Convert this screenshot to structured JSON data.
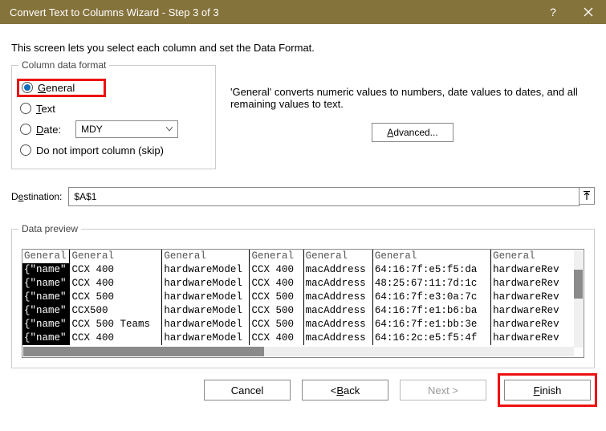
{
  "title": "Convert Text to Columns Wizard - Step 3 of 3",
  "instructions": "This screen lets you select each column and set the Data Format.",
  "format_fieldset": {
    "legend": "Column data format",
    "general": "General",
    "text": "Text",
    "date": "Date:",
    "date_value": "MDY",
    "skip": "Do not import column (skip)"
  },
  "description": "'General' converts numeric values to numbers, date values to dates, and all remaining values to text.",
  "advanced": "Advanced...",
  "destination_label": "Destination:",
  "destination_value": "$A$1",
  "preview_legend": "Data preview",
  "headers": [
    "General",
    "General",
    "General",
    "General",
    "General",
    "General",
    "General"
  ],
  "rows": [
    [
      "{\"name\"",
      "CCX 400",
      "hardwareModel",
      "CCX 400",
      "macAddress",
      "64:16:7f:e5:f5:da",
      "hardwareRev"
    ],
    [
      "{\"name\"",
      "CCX 400",
      "hardwareModel",
      "CCX 400",
      "macAddress",
      "48:25:67:11:7d:1c",
      "hardwareRev"
    ],
    [
      "{\"name\"",
      "CCX 500",
      "hardwareModel",
      "CCX 500",
      "macAddress",
      "64:16:7f:e3:0a:7c",
      "hardwareRev"
    ],
    [
      "{\"name\"",
      "CCX500",
      "hardwareModel",
      "CCX 500",
      "macAddress",
      "64:16:7f:e1:b6:ba",
      "hardwareRev"
    ],
    [
      "{\"name\"",
      "CCX 500  Teams",
      "hardwareModel",
      "CCX 500",
      "macAddress",
      "64:16:7f:e1:bb:3e",
      "hardwareRev"
    ],
    [
      "{\"name\"",
      "CCX 400",
      "hardwareModel",
      "CCX 400",
      "macAddress",
      "64:16:2c:e5:f5:4f",
      "hardwareRev"
    ]
  ],
  "buttons": {
    "cancel": "Cancel",
    "back": "< Back",
    "next": "Next >",
    "finish": "Finish"
  }
}
